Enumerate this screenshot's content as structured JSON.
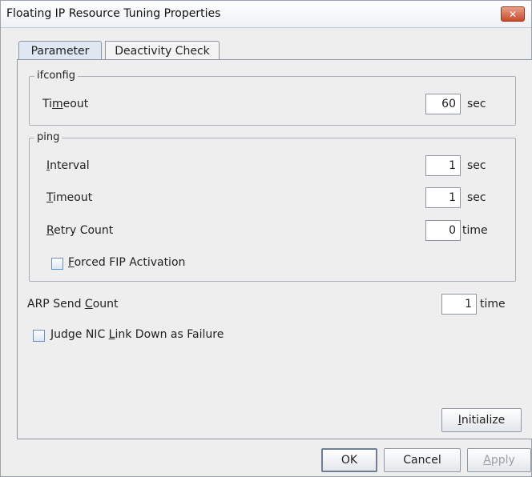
{
  "window": {
    "title": "Floating IP Resource Tuning Properties",
    "close_glyph": "✕"
  },
  "tabs": [
    {
      "label": "Parameter",
      "active": true
    },
    {
      "label": "Deactivity Check",
      "active": false
    }
  ],
  "ifconfig": {
    "legend": "ifconfig",
    "timeout": {
      "label_pre": "Ti",
      "label_mnemonic": "m",
      "label_post": "eout",
      "value": "60",
      "unit": "sec"
    }
  },
  "ping": {
    "legend": "ping",
    "interval": {
      "label_pre": "",
      "label_mnemonic": "I",
      "label_post": "nterval",
      "value": "1",
      "unit": "sec"
    },
    "timeout": {
      "label_pre": "",
      "label_mnemonic": "T",
      "label_post": "imeout",
      "value": "1",
      "unit": "sec"
    },
    "retry": {
      "label_pre": "",
      "label_mnemonic": "R",
      "label_post": "etry Count",
      "value": "0",
      "unit": "time"
    },
    "forced_fip": {
      "label_pre": "",
      "label_mnemonic": "F",
      "label_post": "orced FIP Activation",
      "checked": false
    }
  },
  "arp": {
    "label_pre": "ARP Send ",
    "label_mnemonic": "C",
    "label_post": "ount",
    "value": "1",
    "unit": "time"
  },
  "judge_nic": {
    "label_pre": "Judge NIC ",
    "label_mnemonic": "L",
    "label_post": "ink Down as Failure",
    "checked": false
  },
  "buttons": {
    "initialize": {
      "label_pre": "",
      "label_mnemonic": "I",
      "label_post": "nitialize"
    },
    "ok": "OK",
    "cancel": "Cancel",
    "apply": {
      "label_pre": "",
      "label_mnemonic": "A",
      "label_post": "pply"
    }
  }
}
